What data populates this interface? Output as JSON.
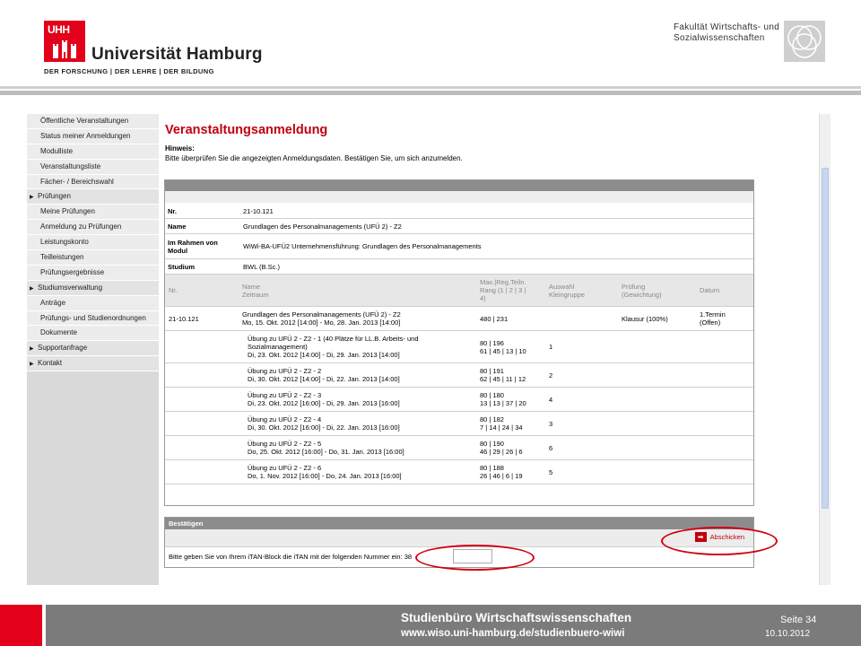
{
  "header": {
    "logo_text": "UHH",
    "university": "Universität Hamburg",
    "tagline": "DER FORSCHUNG | DER LEHRE | DER BILDUNG",
    "faculty_line1": "Fakultät Wirtschafts- und",
    "faculty_line2": "Sozialwissenschaften"
  },
  "sidebar": {
    "items": [
      {
        "label": "Öffentliche Veranstaltungen",
        "section": false
      },
      {
        "label": "Status meiner Anmeldungen",
        "section": false
      },
      {
        "label": "Modulliste",
        "section": false
      },
      {
        "label": "Veranstaltungsliste",
        "section": false
      },
      {
        "label": "Fächer- / Bereichswahl",
        "section": false
      },
      {
        "label": "Prüfungen",
        "section": true
      },
      {
        "label": "Meine Prüfungen",
        "section": false
      },
      {
        "label": "Anmeldung zu Prüfungen",
        "section": false
      },
      {
        "label": "Leistungskonto",
        "section": false
      },
      {
        "label": "Teilleistungen",
        "section": false
      },
      {
        "label": "Prüfungsergebnisse",
        "section": false
      },
      {
        "label": "Studiumsverwaltung",
        "section": true
      },
      {
        "label": "Anträge",
        "section": false
      },
      {
        "label": "Prüfungs- und Studienordnungen",
        "section": false
      },
      {
        "label": "Dokumente",
        "section": false
      },
      {
        "label": "Supportanfrage",
        "section": true
      },
      {
        "label": "Kontakt",
        "section": true
      }
    ]
  },
  "main": {
    "title": "Veranstaltungsanmeldung",
    "hint_label": "Hinweis:",
    "hint_text": "Bitte überprüfen Sie die angezeigten Anmeldungsdaten. Bestätigen Sie, um sich anzumelden.",
    "info": {
      "nr_label": "Nr.",
      "nr_value": "21-10.121",
      "name_label": "Name",
      "name_value": "Grundlagen des Personalmanagements (UFÜ 2) - Z2",
      "modul_label": "Im Rahmen von Modul",
      "modul_value": "WiWi-BA-UFÜ2 Unternehmensführung: Grundlagen des Personalmanagements",
      "studium_label": "Studium",
      "studium_value": "BWL (B.Sc.)"
    },
    "columns": {
      "nr": "Nr.",
      "name1": "Name",
      "name2": "Zeitraum",
      "max1": "Max.|Reg.Teiln.",
      "max2": "Rang (1 | 2 | 3 |",
      "max3": "4)",
      "kl1": "Auswahl",
      "kl2": "Kleingruppe",
      "pr1": "Prüfung",
      "pr2": "(Gewichtung)",
      "dat": "Datum"
    },
    "main_row": {
      "nr": "21-10.121",
      "name1": "Grundlagen des Personalmanagements (UFÜ 2) - Z2",
      "name2": "Mo, 15. Okt. 2012 [14:00] - Mo, 28. Jan. 2013 [14:00]",
      "max": "480 | 231",
      "pruefung": "Klausur (100%)",
      "datum1": "1.Termin",
      "datum2": "(Offen)"
    },
    "groups": [
      {
        "name1": "Übung zu UFÜ 2 - Z2 - 1 (40 Plätze für LL.B. Arbeits- und",
        "name2": "Sozialmanagement)",
        "name3": "Di, 23. Okt. 2012 [14:00] - Di, 29. Jan. 2013 [14:00]",
        "max1": "80 | 196",
        "max2": "61 | 45 | 13 | 10",
        "choice": "1"
      },
      {
        "name1": "Übung zu UFÜ 2 - Z2 - 2",
        "name2": "",
        "name3": "Di, 30. Okt. 2012 [14:00] - Di, 22. Jan. 2013 [14:00]",
        "max1": "80 | 191",
        "max2": "62 | 45 | 11 | 12",
        "choice": "2"
      },
      {
        "name1": "Übung zu UFÜ 2 - Z2 - 3",
        "name2": "",
        "name3": "Di, 23. Okt. 2012 [16:00] - Di, 29. Jan. 2013 [16:00]",
        "max1": "80 | 180",
        "max2": "13 | 13 | 37 | 20",
        "choice": "4"
      },
      {
        "name1": "Übung zu UFÜ 2 - Z2 - 4",
        "name2": "",
        "name3": "Di, 30. Okt. 2012 [16:00] - Di, 22. Jan. 2013 [16:00]",
        "max1": "80 | 182",
        "max2": "7 | 14 | 24 | 34",
        "choice": "3"
      },
      {
        "name1": "Übung zu UFÜ 2 - Z2 - 5",
        "name2": "",
        "name3": "Do, 25. Okt. 2012 [16:00] - Do, 31. Jan. 2013 [16:00]",
        "max1": "80 | 190",
        "max2": "46 | 29 | 26 | 6",
        "choice": "6"
      },
      {
        "name1": "Übung zu UFÜ 2 - Z2 - 6",
        "name2": "",
        "name3": "Do, 1. Nov. 2012 [16:00] - Do, 24. Jan. 2013 [16:00]",
        "max1": "80 | 188",
        "max2": "26 | 46 | 6 | 19",
        "choice": "5"
      }
    ],
    "confirm": {
      "heading": "Bestätigen",
      "send_label": "Abschicken",
      "send_icon": "arrow-right-icon",
      "itan_label": "Bitte geben Sie von Ihrem iTAN-Block die iTAN mit der folgenden Nummer ein:",
      "itan_number": "38",
      "itan_value": ""
    }
  },
  "footer": {
    "line1": "Studienbüro Wirtschaftswissenschaften",
    "line2": "www.wiso.uni-hamburg.de/studienbuero-wiwi",
    "page": "Seite 34",
    "date": "10.10.2012"
  },
  "colors": {
    "uhh_red": "#e2001a",
    "title_red": "#c0000d",
    "annotation_red": "#d20014",
    "footer_gray": "#7b7b7b"
  }
}
